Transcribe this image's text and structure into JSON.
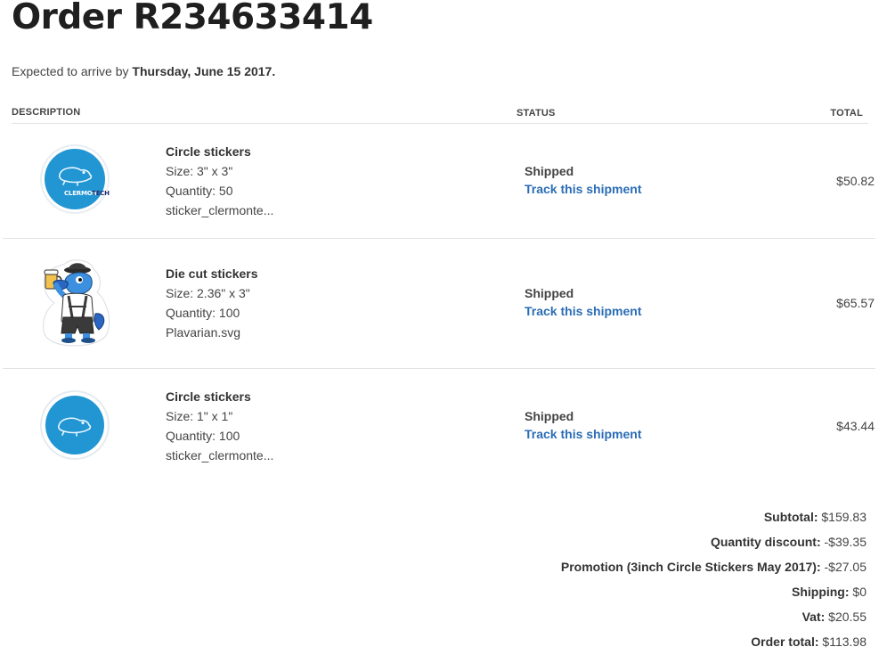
{
  "order": {
    "title": "Order R234633414",
    "arrival_prefix": "Expected to arrive by ",
    "arrival_date": "Thursday, June 15 2017."
  },
  "table": {
    "headers": {
      "description": "DESCRIPTION",
      "status": "STATUS",
      "total": "TOTAL"
    },
    "items": [
      {
        "name": "Circle stickers",
        "size": "Size: 3\" x 3\"",
        "quantity": "Quantity: 50",
        "file": "sticker_clermonte...",
        "status": "Shipped",
        "track_label": "Track this shipment",
        "total": "$50.82",
        "image": "clermontech-circle-sticker"
      },
      {
        "name": "Die cut stickers",
        "size": "Size: 2.36\" x 3\"",
        "quantity": "Quantity: 100",
        "file": "Plavarian.svg",
        "status": "Shipped",
        "track_label": "Track this shipment",
        "total": "$65.57",
        "image": "platypus-bavarian-die-cut-sticker"
      },
      {
        "name": "Circle stickers",
        "size": "Size: 1\" x 1\"",
        "quantity": "Quantity: 100",
        "file": "sticker_clermonte...",
        "status": "Shipped",
        "track_label": "Track this shipment",
        "total": "$43.44",
        "image": "platypus-circle-sticker"
      }
    ]
  },
  "summary": {
    "subtotal_label": "Subtotal:",
    "subtotal_value": "$159.83",
    "discount_label": "Quantity discount:",
    "discount_value": "-$39.35",
    "promotion_label": "Promotion (3inch Circle Stickers May 2017):",
    "promotion_value": "-$27.05",
    "shipping_label": "Shipping:",
    "shipping_value": "$0",
    "vat_label": "Vat:",
    "vat_value": "$20.55",
    "total_label": "Order total:",
    "total_value": "$113.98"
  },
  "brand": {
    "sticker_blue": "#2196d3",
    "link_blue": "#2a6db5",
    "sticker_text_dark": "#1a2a6e",
    "sticker_text_light": "#ffffff",
    "sticker_logo_text": "CLERMONTECH"
  },
  "colors": {
    "text": "#333333",
    "divider": "#e3e3e3"
  }
}
